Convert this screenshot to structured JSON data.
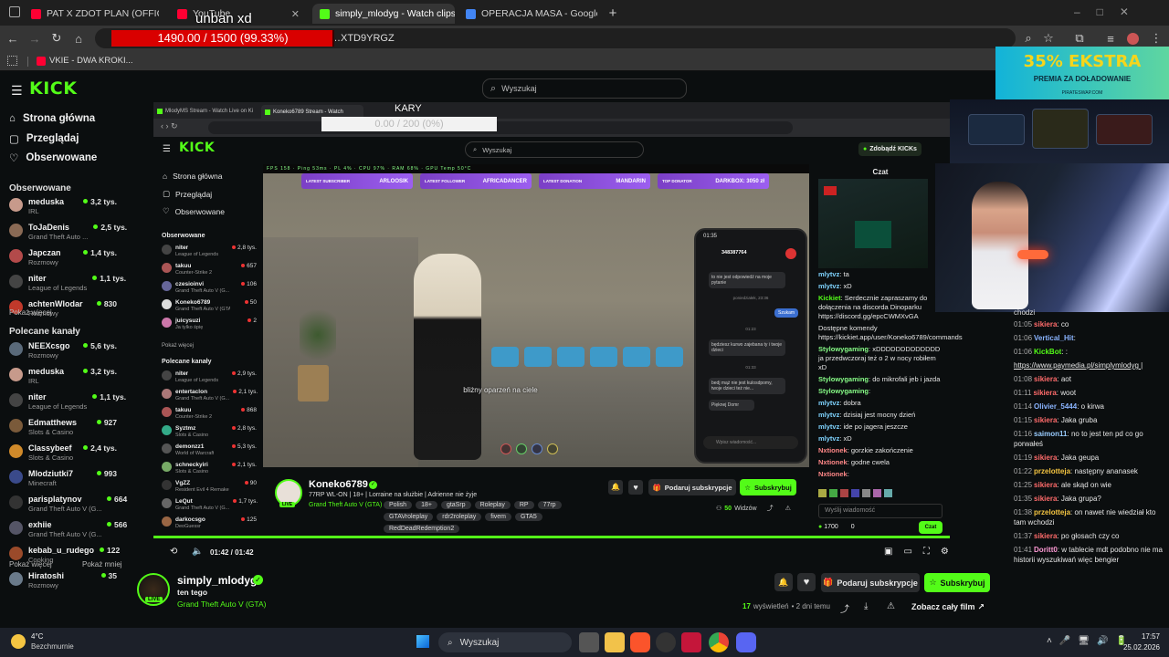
{
  "browser": {
    "tabs": [
      {
        "title": "PAT X ZDOT PLAN (OFFICAL M",
        "color": "#ff0033"
      },
      {
        "title": "YouTube",
        "color": "#ff0033"
      },
      {
        "title": "simply_mlodyg - Watch clips o",
        "color": "#53fc18"
      },
      {
        "title": "OPERACJA MASA - Google Doc",
        "color": "#4285f4"
      }
    ],
    "new_tab": "+",
    "url": "…XTD9YRGZ",
    "bookmark": "VKIE - DWA KROKI..."
  },
  "overlays": {
    "unban_title": "unban xd",
    "unban_progress": "1490.00 / 1500 (99.33%)",
    "unban_fraction": 0.9933,
    "kary_title": "KARY",
    "kary_progress": "0.00 / 200 (0%)",
    "ad_big": "35% EKSTRA",
    "ad_small": "PREMIA ZA DOŁADOWANIE",
    "ad_domain": "PIRATESWAP.COM"
  },
  "kick": {
    "logo": "KICK",
    "search_placeholder": "Wyszukaj",
    "nav": [
      "Strona główna",
      "Przeglądaj",
      "Obserwowane"
    ],
    "followed_title": "Obserwowane",
    "followed": [
      {
        "name": "meduska",
        "game": "IRL",
        "viewers": "3,2 tys.",
        "color": "#c79a8b"
      },
      {
        "name": "ToJaDenis",
        "game": "Grand Theft Auto ...",
        "viewers": "2,5 tys.",
        "color": "#8a6a55"
      },
      {
        "name": "Japczan",
        "game": "Rozmowy",
        "viewers": "1,4 tys.",
        "color": "#b34a4a"
      },
      {
        "name": "niter",
        "game": "League of Legends",
        "viewers": "1,1 tys.",
        "color": "#444"
      },
      {
        "name": "achtenWlodar",
        "game": "Rozmowy",
        "viewers": "830",
        "color": "#c0392b"
      }
    ],
    "show_more": "Pokaż więcej",
    "recommended_title": "Polecane kanały",
    "recommended": [
      {
        "name": "NEEXcsgo",
        "game": "Rozmowy",
        "viewers": "5,6 tys.",
        "color": "#5a6a7a"
      },
      {
        "name": "meduska",
        "game": "IRL",
        "viewers": "3,2 tys.",
        "color": "#c79a8b"
      },
      {
        "name": "niter",
        "game": "League of Legends",
        "viewers": "1,1 tys.",
        "color": "#444"
      },
      {
        "name": "Edmatthews",
        "game": "Slots & Casino",
        "viewers": "927",
        "color": "#7a5a3a"
      },
      {
        "name": "Classybeef",
        "game": "Slots & Casino",
        "viewers": "2,4 tys.",
        "color": "#d08a2a"
      },
      {
        "name": "Mlodziutki7",
        "game": "Minecraft",
        "viewers": "993",
        "color": "#3a4a8a"
      },
      {
        "name": "parisplatynov",
        "game": "Grand Theft Auto V (G...",
        "viewers": "664",
        "color": "#333"
      },
      {
        "name": "exhiie",
        "game": "Grand Theft Auto V (G...",
        "viewers": "566",
        "color": "#556"
      },
      {
        "name": "kebab_u_rudego",
        "game": "Cooking",
        "viewers": "122",
        "color": "#9a4a2a"
      },
      {
        "name": "Hiratoshi",
        "game": "Rozmowy",
        "viewers": "35",
        "color": "#6a7a8a"
      }
    ],
    "show_less": "Pokaż mniej",
    "streamer": {
      "name": "simply_mlodyg",
      "title": "ten tego",
      "category": "Grand Theft Auto V (GTA)",
      "live": "LIVE",
      "views_count": "17",
      "views_label": "wyświetleń",
      "ago": "• 2 dni temu",
      "gift_label": "Podaruj subskrypcje",
      "sub_label": "Subskrybuj",
      "full_film": "Zobacz cały film"
    },
    "chat": [
      {
        "t": "01:05",
        "u": "sikiera",
        "m": "co",
        "c": "#ff6b6b"
      },
      {
        "t": "01:06",
        "u": "Vertical_Hit",
        "m": "",
        "c": "#8ab4ff"
      },
      {
        "t": "01:06",
        "u": "KickBot",
        "m": ":",
        "c": "#53fc18"
      },
      {
        "t": "",
        "u": "",
        "m": "https://www.paymedia.pl/simplymlodyg |",
        "c": "#fff"
      },
      {
        "t": "01:08",
        "u": "sikiera",
        "m": "aot",
        "c": "#ff6b6b"
      },
      {
        "t": "01:11",
        "u": "sikiera",
        "m": "woot",
        "c": "#ff6b6b"
      },
      {
        "t": "01:14",
        "u": "Olivier_5444",
        "m": "o kirwa",
        "c": "#8ab4ff"
      },
      {
        "t": "01:15",
        "u": "sikiera",
        "m": "Jaka gruba",
        "c": "#ff6b6b"
      },
      {
        "t": "01:16",
        "u": "saimon11",
        "m": "no to jest ten pd co go porwałeś",
        "c": "#9cf"
      },
      {
        "t": "01:19",
        "u": "sikiera",
        "m": "Jaka geupa",
        "c": "#ff6b6b"
      },
      {
        "t": "01:22",
        "u": "przelotteja",
        "m": "następny ananasek",
        "c": "#f5c542"
      },
      {
        "t": "01:25",
        "u": "sikiera",
        "m": "ale skąd on wie",
        "c": "#ff6b6b"
      },
      {
        "t": "01:35",
        "u": "sikiera",
        "m": "Jaka grupa?",
        "c": "#ff6b6b"
      },
      {
        "t": "01:38",
        "u": "przelotteja",
        "m": "on nawet nie wiedział kto tam wchodzi",
        "c": "#f5c542"
      },
      {
        "t": "01:37",
        "u": "sikiera",
        "m": "po głosach czy co",
        "c": "#ff6b6b"
      },
      {
        "t": "01:41",
        "u": "Doritt0",
        "m": "w tablecie mdt podobno nie ma historii wyszukiwań więc bengier",
        "c": "#ff9ad5"
      }
    ],
    "chat_top": "chodzi"
  },
  "inner": {
    "tabs": [
      "MlodyMS Stream - Watch Live on Ki",
      "Koneko6789 Stream - Watch"
    ],
    "search_placeholder": "Wyszukaj",
    "zdobadz": "Zdobądź KICKs",
    "nav": [
      "Strona główna",
      "Przeglądaj",
      "Obserwowane"
    ],
    "followed_title": "Obserwowane",
    "followed": [
      {
        "name": "niter",
        "game": "League of Legends",
        "viewers": "2,8 tys.",
        "color": "#444"
      },
      {
        "name": "takuu",
        "game": "Counter-Strike 2",
        "viewers": "657",
        "color": "#a55"
      },
      {
        "name": "czesioinvi",
        "game": "Grand Theft Auto V (G...",
        "viewers": "106",
        "color": "#669"
      },
      {
        "name": "Koneko6789",
        "game": "Grand Theft Auto V (GTA)",
        "viewers": "50",
        "color": "#ddd"
      },
      {
        "name": "juicysuzi",
        "game": "Ja tylko śpię",
        "viewers": "2",
        "color": "#c7a"
      }
    ],
    "show_more": "Pokaż więcej",
    "recommended_title": "Polecane kanały",
    "recommended": [
      {
        "name": "niter",
        "game": "League of Legends",
        "viewers": "2,9 tys.",
        "color": "#444"
      },
      {
        "name": "entertaclon",
        "game": "Grand Theft Auto V (G...",
        "viewers": "2,1 tys.",
        "color": "#a77"
      },
      {
        "name": "takuu",
        "game": "Counter-Strike 2",
        "viewers": "868",
        "color": "#a55"
      },
      {
        "name": "Syztmz",
        "game": "Slots & Casino",
        "viewers": "2,8 tys.",
        "color": "#3a8"
      },
      {
        "name": "demonzz1",
        "game": "World of Warcraft",
        "viewers": "5,3 tys.",
        "color": "#555"
      },
      {
        "name": "schneckyiri",
        "game": "Slots & Casino",
        "viewers": "2,1 tys.",
        "color": "#7a6"
      },
      {
        "name": "VgZZ",
        "game": "Resident Evil 4 Remake",
        "viewers": "90",
        "color": "#333"
      },
      {
        "name": "LeQut",
        "game": "Grand Theft Auto V (G...",
        "viewers": "1,7 tys.",
        "color": "#666"
      },
      {
        "name": "darkocsgo",
        "game": "DeoGuessr",
        "viewers": "125",
        "color": "#964"
      }
    ],
    "alerts": [
      {
        "label": "LATEST SUBSCRIBER",
        "name": "ARLOOSIK"
      },
      {
        "label": "LATEST FOLLOWER",
        "name": "AFRICADANCER"
      },
      {
        "label": "LATEST DONATION",
        "name": "MANDARIN"
      },
      {
        "label": "TOP DONATOR",
        "name": "DARKBOX: 3050 zł"
      }
    ],
    "subtitle": "bliżny oparzeń na ciele",
    "phone": {
      "time": "01:35",
      "contact": "348387764",
      "m1": "to nie jest odpowiedź na moje pytanie",
      "day": "poniedziałek, 23:36",
      "me": "Szukam",
      "t2": "01:23",
      "m2": "będziesz kurwo zajebana ty i twoje dzieci",
      "t3": "01:33",
      "m3": "bedj mąż nie jest kulosdpomy, twoje dzieci też nie...",
      "m4": "Pięknej Domr",
      "input": "Wpisz wiadomość..."
    },
    "streamer": {
      "name": "Koneko6789",
      "title": "77RP WL-ON | 18+ | Lorraine na służbie | Adrienne nie żyje",
      "category": "Grand Theft Auto V (GTA)",
      "tags": [
        "Polish",
        "18+",
        "gtaSrp",
        "Roleplay",
        "RP",
        "77rp",
        "GTAVroleplay",
        "rdr2roleplay",
        "fivem",
        "GTA5",
        "RedDeadRedemption2"
      ],
      "gift": "Podaruj subskrypcje",
      "sub": "Subskrybuj",
      "viewers": "50",
      "viewers_label": "Widzów"
    },
    "chat_title": "Czat",
    "chat": [
      {
        "u": "mlytvz",
        "m": "ta",
        "c": "#7fd4ff"
      },
      {
        "u": "mlytvz",
        "m": "xD",
        "c": "#7fd4ff"
      },
      {
        "u": "Kickiet",
        "m": "Serdecznie zapraszamy do dołączenia na discorda Dinoparku https://discord.gg/epcCWMXvGA",
        "c": "#53fc18"
      },
      {
        "u": "",
        "m": "Dostępne komendy https://kickiet.app/user/Koneko6789/commands",
        "c": "#fff"
      },
      {
        "u": "Stylowygaming",
        "m": "xDDDDDDDDDDDDD ja przedwczoraj też o 2 w nocy robiłem xD",
        "c": "#8f8"
      },
      {
        "u": "Stylowygaming",
        "m": "do mikrofali jeb i jazda",
        "c": "#8f8"
      },
      {
        "u": "Stylowygaming",
        "m": "",
        "c": "#8f8"
      },
      {
        "u": "mlytvz",
        "m": "dobra",
        "c": "#7fd4ff"
      },
      {
        "u": "mlytvz",
        "m": "dzisiaj jest mocny dzień",
        "c": "#7fd4ff"
      },
      {
        "u": "mlytvz",
        "m": "ide po jagera jeszcze",
        "c": "#7fd4ff"
      },
      {
        "u": "mlytvz",
        "m": "xD",
        "c": "#7fd4ff"
      },
      {
        "u": "Nxtionek",
        "m": "gorzkie zakończenie",
        "c": "#f88"
      },
      {
        "u": "Nxtionek",
        "m": "godne cwela",
        "c": "#f88"
      },
      {
        "u": "Nxtionek",
        "m": "",
        "c": "#f88"
      }
    ],
    "send_placeholder": "Wyślij wiadomość",
    "kicks": "1700",
    "zero": "0",
    "send": "Czat",
    "time": "01:42 / 01:42"
  },
  "taskbar": {
    "temp": "4°C",
    "weather": "Bezchmurnie",
    "search": "Wyszukaj",
    "time": "17:57",
    "date": "25.02.2026"
  }
}
